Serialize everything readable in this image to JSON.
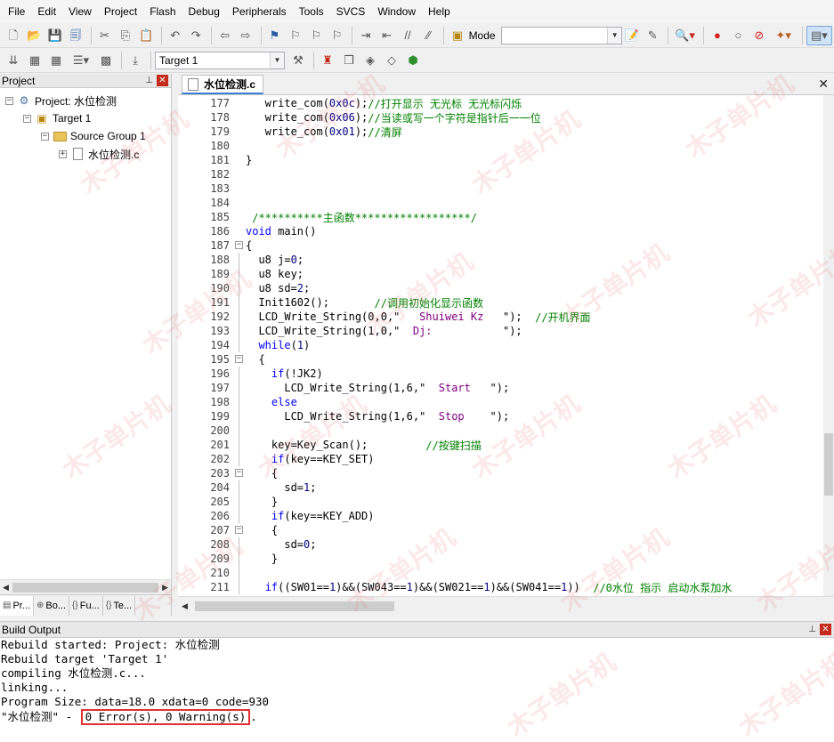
{
  "menu": [
    "File",
    "Edit",
    "View",
    "Project",
    "Flash",
    "Debug",
    "Peripherals",
    "Tools",
    "SVCS",
    "Window",
    "Help"
  ],
  "toolbar": {
    "mode_label": "Mode",
    "target_value": "Target 1"
  },
  "project_panel": {
    "title": "Project",
    "tree": [
      {
        "label": "Project: 水位检测",
        "level": 0,
        "icon": "project-icon",
        "expander": "−"
      },
      {
        "label": "Target 1",
        "level": 1,
        "icon": "target-icon",
        "expander": "−"
      },
      {
        "label": "Source Group 1",
        "level": 2,
        "icon": "folder-icon",
        "expander": "−"
      },
      {
        "label": "水位检测.c",
        "level": 3,
        "icon": "file-icon",
        "expander": "+"
      }
    ],
    "tabs": [
      {
        "label": "Pr...",
        "icon": "book-icon"
      },
      {
        "label": "Bo...",
        "icon": "books-icon"
      },
      {
        "label": "Fu...",
        "icon": "braces-icon"
      },
      {
        "label": "Te...",
        "icon": "template-icon"
      }
    ]
  },
  "editor": {
    "tab_label": "水位检测.c",
    "lines": [
      {
        "n": "177",
        "fold": "",
        "parts": [
          [
            "code",
            "   write_com("
          ],
          [
            "num",
            "0x0c"
          ],
          [
            "code",
            ");"
          ],
          [
            "cm",
            "//打开显示 无光标 无光标闪烁"
          ]
        ]
      },
      {
        "n": "178",
        "fold": "",
        "parts": [
          [
            "code",
            "   write_com("
          ],
          [
            "num",
            "0x06"
          ],
          [
            "code",
            ");"
          ],
          [
            "cm",
            "//当读或写一个字符是指针后一一位"
          ]
        ]
      },
      {
        "n": "179",
        "fold": "",
        "parts": [
          [
            "code",
            "   write_com("
          ],
          [
            "num",
            "0x01"
          ],
          [
            "code",
            ");"
          ],
          [
            "cm",
            "//清屏"
          ]
        ]
      },
      {
        "n": "180",
        "fold": "",
        "parts": []
      },
      {
        "n": "181",
        "fold": "",
        "parts": [
          [
            "code",
            "}"
          ]
        ]
      },
      {
        "n": "182",
        "fold": "",
        "parts": []
      },
      {
        "n": "183",
        "fold": "",
        "parts": []
      },
      {
        "n": "184",
        "fold": "",
        "parts": []
      },
      {
        "n": "185",
        "fold": "",
        "parts": [
          [
            "cm",
            " /**********主函数******************/"
          ]
        ]
      },
      {
        "n": "186",
        "fold": "",
        "parts": [
          [
            "kw",
            "void"
          ],
          [
            "code",
            " main()"
          ]
        ]
      },
      {
        "n": "187",
        "fold": "-",
        "parts": [
          [
            "code",
            "{"
          ]
        ]
      },
      {
        "n": "188",
        "fold": "|",
        "parts": [
          [
            "code",
            "  u8 j="
          ],
          [
            "num",
            "0"
          ],
          [
            "code",
            ";"
          ]
        ]
      },
      {
        "n": "189",
        "fold": "|",
        "parts": [
          [
            "code",
            "  u8 key;"
          ]
        ]
      },
      {
        "n": "190",
        "fold": "|",
        "parts": [
          [
            "code",
            "  u8 sd="
          ],
          [
            "num",
            "2"
          ],
          [
            "code",
            ";"
          ]
        ]
      },
      {
        "n": "191",
        "fold": "|",
        "parts": [
          [
            "code",
            "  Init1602();       "
          ],
          [
            "cm",
            "//调用初始化显示函数"
          ]
        ]
      },
      {
        "n": "192",
        "fold": "|",
        "parts": [
          [
            "code",
            "  LCD_Write_String(0,0,\""
          ],
          [
            "str",
            "   Shuiwei Kz   "
          ],
          [
            "code",
            "\");  "
          ],
          [
            "cm",
            "//开机界面"
          ]
        ]
      },
      {
        "n": "193",
        "fold": "|",
        "parts": [
          [
            "code",
            "  LCD_Write_String(1,0,\""
          ],
          [
            "str",
            "  Dj:           "
          ],
          [
            "code",
            "\");"
          ]
        ]
      },
      {
        "n": "194",
        "fold": "|",
        "parts": [
          [
            "code",
            "  "
          ],
          [
            "kw",
            "while"
          ],
          [
            "code",
            "("
          ],
          [
            "num",
            "1"
          ],
          [
            "code",
            ")"
          ]
        ]
      },
      {
        "n": "195",
        "fold": "-",
        "parts": [
          [
            "code",
            "  {"
          ]
        ]
      },
      {
        "n": "196",
        "fold": "|",
        "parts": [
          [
            "code",
            "    "
          ],
          [
            "kw",
            "if"
          ],
          [
            "code",
            "(!JK2)"
          ]
        ]
      },
      {
        "n": "197",
        "fold": "|",
        "parts": [
          [
            "code",
            "      LCD_Write_String(1,6,\""
          ],
          [
            "str",
            "  Start   "
          ],
          [
            "code",
            "\");"
          ]
        ]
      },
      {
        "n": "198",
        "fold": "|",
        "parts": [
          [
            "code",
            "    "
          ],
          [
            "kw",
            "else"
          ]
        ]
      },
      {
        "n": "199",
        "fold": "|",
        "parts": [
          [
            "code",
            "      LCD_Write_String(1,6,\""
          ],
          [
            "str",
            "  Stop    "
          ],
          [
            "code",
            "\");"
          ]
        ]
      },
      {
        "n": "200",
        "fold": "|",
        "parts": []
      },
      {
        "n": "201",
        "fold": "|",
        "parts": [
          [
            "code",
            "    key=Key_Scan();         "
          ],
          [
            "cm",
            "//按键扫描"
          ]
        ]
      },
      {
        "n": "202",
        "fold": "|",
        "parts": [
          [
            "code",
            "    "
          ],
          [
            "kw",
            "if"
          ],
          [
            "code",
            "(key==KEY_SET)"
          ]
        ]
      },
      {
        "n": "203",
        "fold": "-",
        "parts": [
          [
            "code",
            "    {"
          ]
        ]
      },
      {
        "n": "204",
        "fold": "|",
        "parts": [
          [
            "code",
            "      sd="
          ],
          [
            "num",
            "1"
          ],
          [
            "code",
            ";"
          ]
        ]
      },
      {
        "n": "205",
        "fold": "|",
        "parts": [
          [
            "code",
            "    }"
          ]
        ]
      },
      {
        "n": "206",
        "fold": "|",
        "parts": [
          [
            "code",
            "    "
          ],
          [
            "kw",
            "if"
          ],
          [
            "code",
            "(key==KEY_ADD)"
          ]
        ]
      },
      {
        "n": "207",
        "fold": "-",
        "parts": [
          [
            "code",
            "    {"
          ]
        ]
      },
      {
        "n": "208",
        "fold": "|",
        "parts": [
          [
            "code",
            "      sd="
          ],
          [
            "num",
            "0"
          ],
          [
            "code",
            ";"
          ]
        ]
      },
      {
        "n": "209",
        "fold": "|",
        "parts": [
          [
            "code",
            "    }"
          ]
        ]
      },
      {
        "n": "210",
        "fold": "|",
        "parts": []
      },
      {
        "n": "211",
        "fold": "|",
        "parts": [
          [
            "code",
            "   "
          ],
          [
            "kw",
            "if"
          ],
          [
            "code",
            "((SW01=="
          ],
          [
            "num",
            "1"
          ],
          [
            "code",
            ")&&(SW043=="
          ],
          [
            "num",
            "1"
          ],
          [
            "code",
            ")&&(SW021=="
          ],
          [
            "num",
            "1"
          ],
          [
            "code",
            ")&&(SW041=="
          ],
          [
            "num",
            "1"
          ],
          [
            "code",
            "))  "
          ],
          [
            "cm",
            "//0水位 指示 启动水泵加水"
          ]
        ]
      }
    ]
  },
  "build_output": {
    "title": "Build Output",
    "lines": [
      "Rebuild started: Project: 水位检测",
      "Rebuild target 'Target 1'",
      "compiling 水位检测.c...",
      "linking...",
      "Program Size: data=18.0 xdata=0 code=930"
    ],
    "final_prefix": "\"水位检测\" - ",
    "final_result": "0 Error(s), 0 Warning(s)",
    "final_suffix": "."
  },
  "watermark": "木子单片机"
}
